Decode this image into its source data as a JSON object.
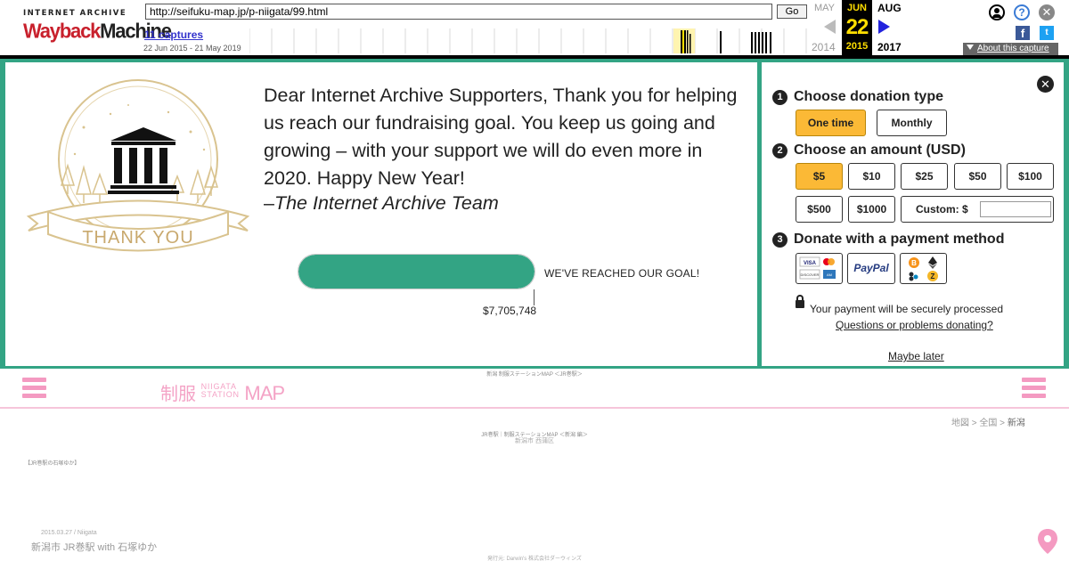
{
  "wayback": {
    "logo_top": "INTERNET ARCHIVE",
    "logo_wayback": "Wayback",
    "logo_machine": "Machine",
    "url": "http://seifuku-map.jp/p-niigata/99.html",
    "go_label": "Go",
    "captures": "11 captures",
    "date_range": "22 Jun 2015 - 21 May 2019",
    "prev_month": "MAY",
    "cur_month": "JUN",
    "cur_day": "22",
    "cur_year": "2015",
    "next_month": "AUG",
    "prev_year": "2014",
    "next_year": "2017",
    "about": "About this capture",
    "accent": "#ffde00"
  },
  "donation": {
    "message": "Dear Internet Archive Supporters, Thank you for helping us reach our fundraising goal. You keep us going and growing – with your support we will do even more in 2020. Happy New Year!",
    "sign_dash": "–",
    "sign": "The Internet Archive Team",
    "thank_you": "THANK YOU",
    "goal_text": "WE'VE REACHED OUR GOAL!",
    "amount": "$7,705,748",
    "progress_fraction": 1.0,
    "accent": "#33a484",
    "selected_color": "#fbb936",
    "close_icon": "close-icon",
    "step1": {
      "num": "1",
      "label": "Choose donation type"
    },
    "types": [
      "One time",
      "Monthly"
    ],
    "step2": {
      "num": "2",
      "label": "Choose an amount (USD)"
    },
    "amounts": [
      "$5",
      "$10",
      "$25",
      "$50",
      "$100",
      "$500",
      "$1000"
    ],
    "custom_label": "Custom: $",
    "custom_value": "",
    "step3": {
      "num": "3",
      "label": "Donate with a payment method"
    },
    "payment_methods": [
      "credit-card-icons",
      "paypal-icon",
      "crypto-icons"
    ],
    "paypal": "PayPal",
    "secure": "Your payment will be securely processed",
    "questions": "Questions or problems donating?",
    "later": "Maybe later"
  },
  "site": {
    "top_breadcrumb": "新潟 制服ステーションMAP ＜JR巻駅＞",
    "logo_kanji": "制服",
    "logo_niigata": "NIIGATA",
    "logo_station": "STATION",
    "logo_map": "MAP",
    "crumb": [
      "地図",
      "全国",
      "新潟"
    ],
    "crumb_sep": " > ",
    "mini1": "JR巻駅｜制服ステーションMAP ＜新潟 編＞",
    "mini2": "新潟市 西蒲区",
    "tag": "【JR巻駅の石塚ゆか】",
    "date": "2015.03.27 / Niigata",
    "title": "新潟市 JR巻駅 with 石塚ゆか",
    "footer": "発行元: Darwin's 株式会社ダーウィンズ",
    "accent": "#f49ac1"
  }
}
